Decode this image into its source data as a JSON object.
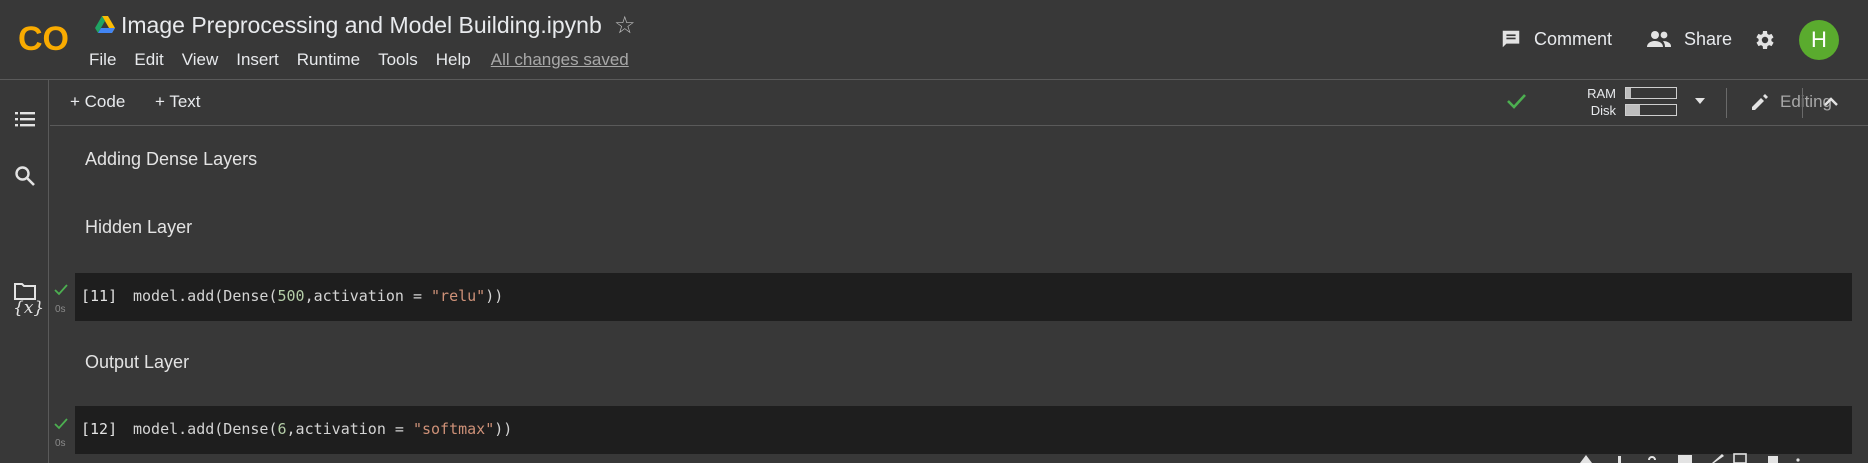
{
  "header": {
    "logo_text": "CO",
    "notebook_title": "Image Preprocessing and Model Building.ipynb",
    "menu": [
      "File",
      "Edit",
      "View",
      "Insert",
      "Runtime",
      "Tools",
      "Help"
    ],
    "save_status": "All changes saved",
    "comment_label": "Comment",
    "share_label": "Share",
    "avatar_letter": "H",
    "avatar_color": "#5aab2e"
  },
  "toolbar": {
    "add_code_label": "+ Code",
    "add_text_label": "+ Text",
    "ram_label": "RAM",
    "disk_label": "Disk",
    "ram_usage": 0.1,
    "disk_usage": 0.28,
    "editing_label": "Editing"
  },
  "cells": {
    "text1": "Adding Dense Layers",
    "text2": "Hidden Layer",
    "code1": {
      "exec_count": "[11]",
      "code_prefix": "model.add(Dense(",
      "code_num": "500",
      "code_mid": ",activation = ",
      "code_str": "\"relu\"",
      "code_suffix": "))",
      "run_time": "0s"
    },
    "text3": "Output Layer",
    "code2": {
      "exec_count": "[12]",
      "code_prefix": "model.add(Dense(",
      "code_num": "6",
      "code_mid": ",activation = ",
      "code_str": "\"softmax\"",
      "code_suffix": "))",
      "run_time": "0s"
    }
  },
  "colors": {
    "background": "#383838",
    "code_background": "#1e1e1e",
    "success_green": "#4caf50",
    "number": "#b5cea8",
    "string": "#ce9178",
    "logo_orange": "#f9ab00"
  }
}
